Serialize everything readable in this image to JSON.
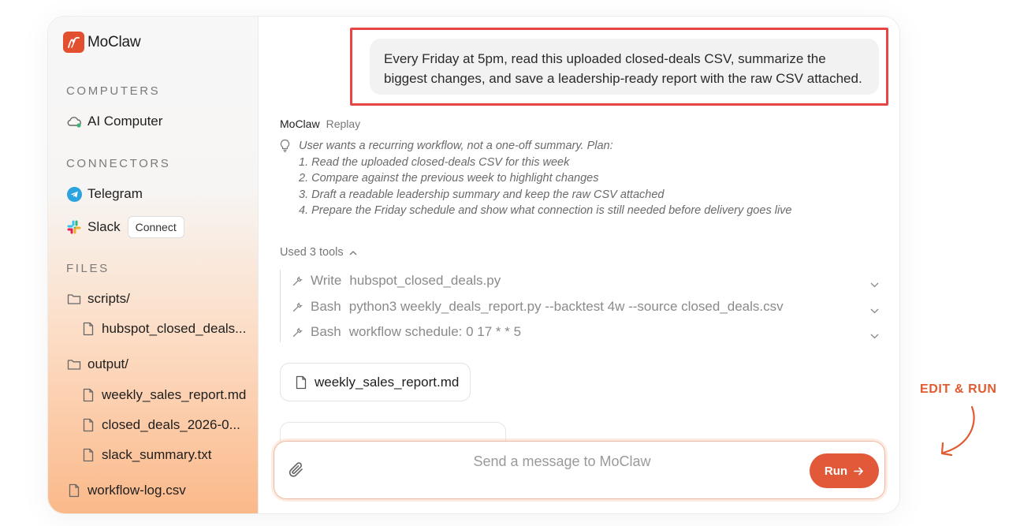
{
  "app": {
    "name": "MoClaw"
  },
  "sidebar": {
    "computers_heading": "COMPUTERS",
    "computers": [
      {
        "label": "AI Computer",
        "icon": "cloud-icon"
      }
    ],
    "connectors_heading": "CONNECTORS",
    "connectors": [
      {
        "label": "Telegram",
        "icon": "telegram-icon"
      },
      {
        "label": "Slack",
        "icon": "slack-icon",
        "action": "Connect"
      }
    ],
    "files_heading": "FILES",
    "files": [
      {
        "label": "scripts/",
        "type": "folder"
      },
      {
        "label": "hubspot_closed_deals...",
        "type": "file"
      },
      {
        "label": "output/",
        "type": "folder"
      },
      {
        "label": "weekly_sales_report.md",
        "type": "file"
      },
      {
        "label": "closed_deals_2026-0...",
        "type": "file"
      },
      {
        "label": "slack_summary.txt",
        "type": "file"
      },
      {
        "label": "workflow-log.csv",
        "type": "file"
      }
    ]
  },
  "chat": {
    "user_message": "Every Friday at 5pm, read this uploaded closed-deals CSV, summarize the biggest changes, and save a leadership-ready report with the raw CSV attached.",
    "assistant_name": "MoClaw",
    "replay_label": "Replay",
    "thought_lines": [
      "User wants a recurring workflow, not a one-off summary. Plan:",
      "1. Read the uploaded closed-deals CSV for this week",
      "2. Compare against the previous week to highlight changes",
      "3. Draft a readable leadership summary and keep the raw CSV attached",
      "4. Prepare the Friday schedule and show what connection is still needed before delivery goes live"
    ],
    "used_tools_label": "Used 3 tools",
    "tools": [
      {
        "verb": "Write",
        "arg": "hubspot_closed_deals.py"
      },
      {
        "verb": "Bash",
        "arg": "python3 weekly_deals_report.py --backtest 4w --source closed_deals.csv"
      },
      {
        "verb": "Bash",
        "arg": "workflow schedule: 0 17 * * 5"
      }
    ],
    "attachment": "weekly_sales_report.md"
  },
  "composer": {
    "placeholder": "Send a message to MoClaw",
    "run_label": "Run"
  },
  "annotation": {
    "label": "EDIT & RUN"
  },
  "colors": {
    "accent": "#e2593a",
    "highlight": "#e64545",
    "annotation": "#e15a30"
  }
}
